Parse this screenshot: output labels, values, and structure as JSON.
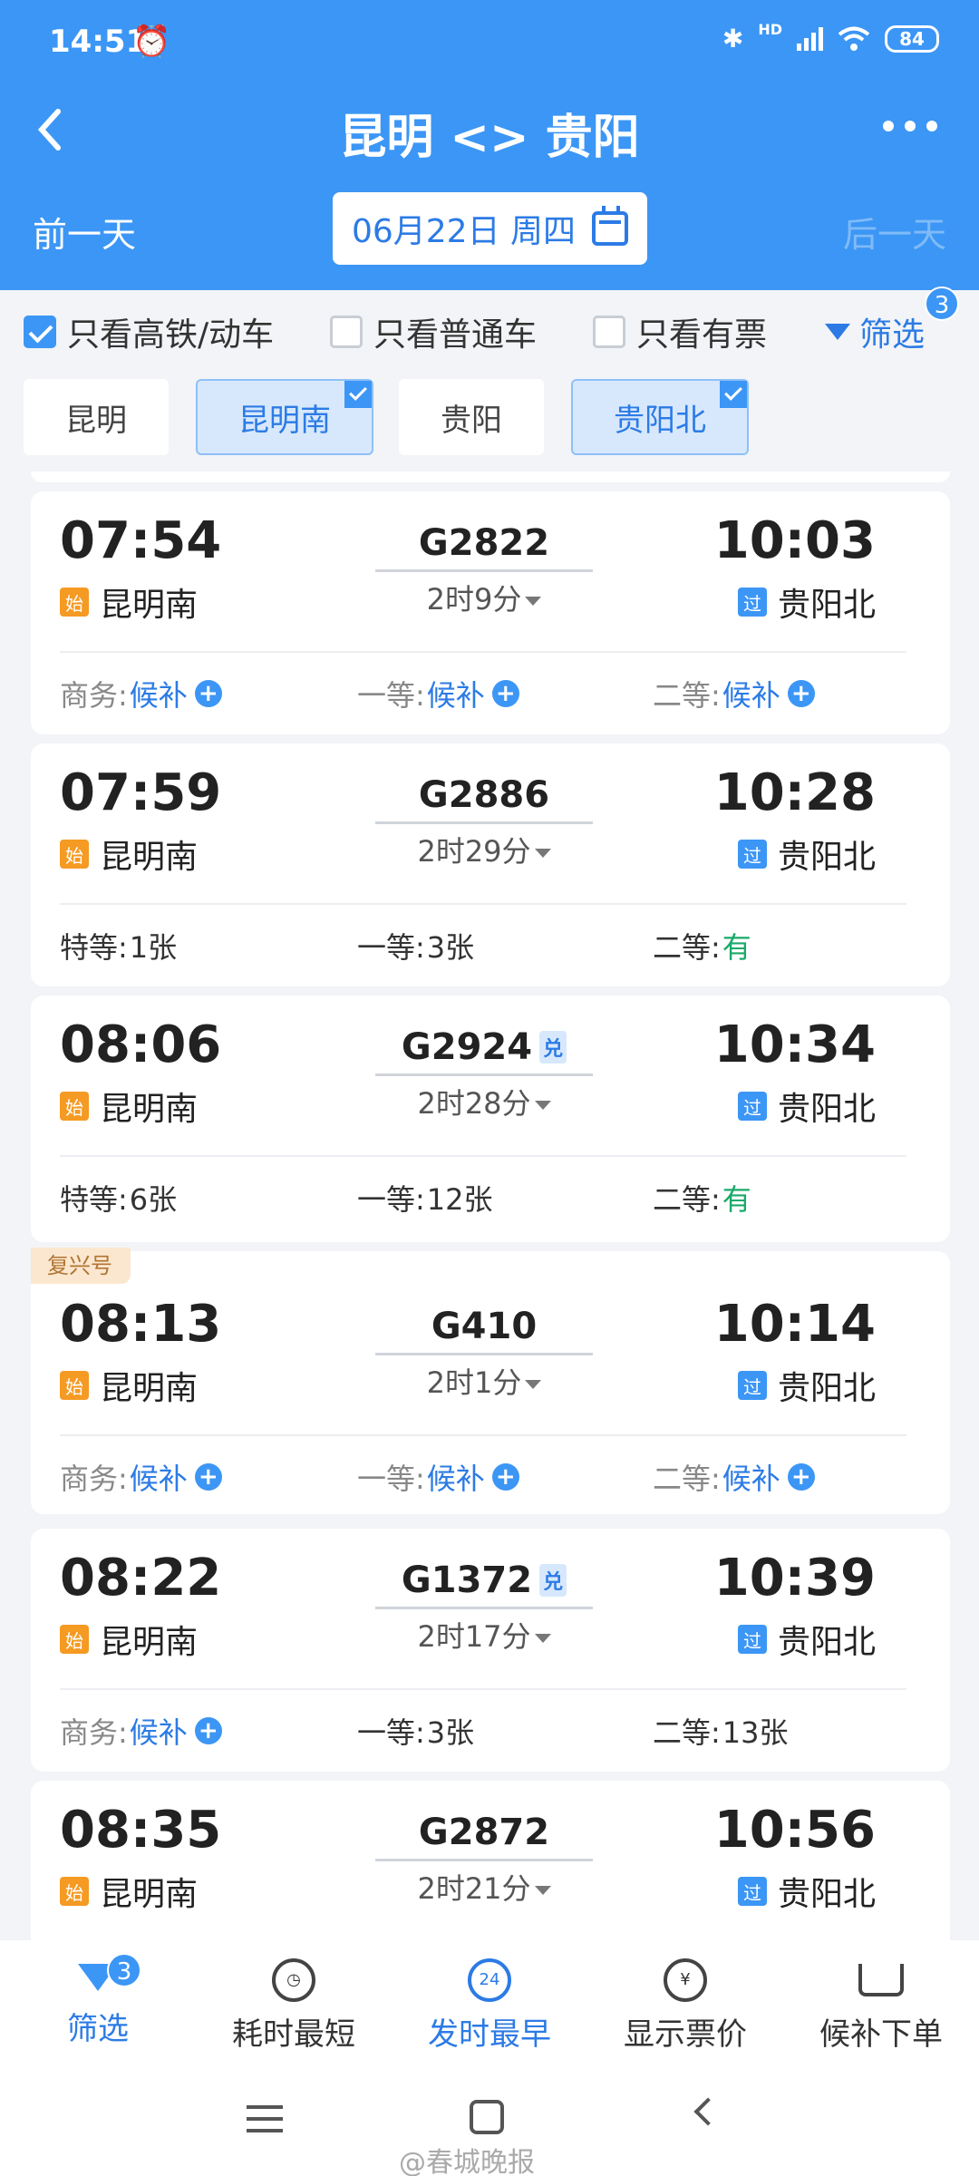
{
  "status": {
    "time": "14:51",
    "alarm_icon": "alarm-icon",
    "bluetooth_icon": "bluetooth-icon",
    "hd": "HD",
    "battery": "84"
  },
  "nav": {
    "back_icon": "back-icon",
    "title": "昆明 <> 贵阳",
    "more_icon": "more-icon"
  },
  "datebar": {
    "prev": "前一天",
    "date": "06月22日 周四",
    "next": "后一天"
  },
  "filters": {
    "high_speed": {
      "label": "只看高铁/动车",
      "checked": true
    },
    "normal": {
      "label": "只看普通车",
      "checked": false
    },
    "available": {
      "label": "只看有票",
      "checked": false
    },
    "filter_label": "筛选",
    "filter_count": "3"
  },
  "stations": [
    {
      "label": "昆明",
      "selected": false
    },
    {
      "label": "昆明南",
      "selected": true
    },
    {
      "label": "贵阳",
      "selected": false
    },
    {
      "label": "贵阳北",
      "selected": true
    }
  ],
  "trains": [
    {
      "dep": "07:54",
      "arr": "10:03",
      "no": "G2822",
      "dui": "",
      "dur": "2时9分",
      "from": "昆明南",
      "to": "贵阳北",
      "from_tag": "始",
      "to_tag": "过",
      "tag": "",
      "seats": [
        {
          "label": "商务:",
          "value": "候补",
          "state": "wait"
        },
        {
          "label": "一等:",
          "value": "候补",
          "state": "wait"
        },
        {
          "label": "二等:",
          "value": "候补",
          "state": "wait"
        }
      ]
    },
    {
      "dep": "07:59",
      "arr": "10:28",
      "no": "G2886",
      "dui": "",
      "dur": "2时29分",
      "from": "昆明南",
      "to": "贵阳北",
      "from_tag": "始",
      "to_tag": "过",
      "tag": "",
      "seats": [
        {
          "label": "特等:",
          "value": "1张",
          "state": "count"
        },
        {
          "label": "一等:",
          "value": "3张",
          "state": "count"
        },
        {
          "label": "二等:",
          "value": "有",
          "state": "has"
        }
      ]
    },
    {
      "dep": "08:06",
      "arr": "10:34",
      "no": "G2924",
      "dui": "兑",
      "dur": "2时28分",
      "from": "昆明南",
      "to": "贵阳北",
      "from_tag": "始",
      "to_tag": "过",
      "tag": "",
      "seats": [
        {
          "label": "特等:",
          "value": "6张",
          "state": "count"
        },
        {
          "label": "一等:",
          "value": "12张",
          "state": "count"
        },
        {
          "label": "二等:",
          "value": "有",
          "state": "has"
        }
      ]
    },
    {
      "dep": "08:13",
      "arr": "10:14",
      "no": "G410",
      "dui": "",
      "dur": "2时1分",
      "from": "昆明南",
      "to": "贵阳北",
      "from_tag": "始",
      "to_tag": "过",
      "tag": "复兴号",
      "seats": [
        {
          "label": "商务:",
          "value": "候补",
          "state": "wait"
        },
        {
          "label": "一等:",
          "value": "候补",
          "state": "wait"
        },
        {
          "label": "二等:",
          "value": "候补",
          "state": "wait"
        }
      ]
    },
    {
      "dep": "08:22",
      "arr": "10:39",
      "no": "G1372",
      "dui": "兑",
      "dur": "2时17分",
      "from": "昆明南",
      "to": "贵阳北",
      "from_tag": "始",
      "to_tag": "过",
      "tag": "",
      "seats": [
        {
          "label": "商务:",
          "value": "候补",
          "state": "wait"
        },
        {
          "label": "一等:",
          "value": "3张",
          "state": "count"
        },
        {
          "label": "二等:",
          "value": "13张",
          "state": "count"
        }
      ]
    },
    {
      "dep": "08:35",
      "arr": "10:56",
      "no": "G2872",
      "dui": "",
      "dur": "2时21分",
      "from": "昆明南",
      "to": "贵阳北",
      "from_tag": "始",
      "to_tag": "过",
      "tag": "",
      "seats": []
    }
  ],
  "toolbar": [
    {
      "label": "筛选",
      "icon": "filter-icon",
      "badge": "3",
      "active": true
    },
    {
      "label": "耗时最短",
      "icon": "timer-icon",
      "badge": "",
      "active": false
    },
    {
      "label": "发时最早",
      "icon": "clock-24-icon",
      "badge": "",
      "active": true
    },
    {
      "label": "显示票价",
      "icon": "yen-icon",
      "badge": "",
      "active": false
    },
    {
      "label": "候补下单",
      "icon": "cart-icon",
      "badge": "",
      "active": false
    }
  ],
  "watermark": "@春城晚报",
  "colors": {
    "primary": "#3c96f5",
    "link": "#2c7be5",
    "available": "#1aa96a",
    "start_tag": "#f59a23"
  }
}
